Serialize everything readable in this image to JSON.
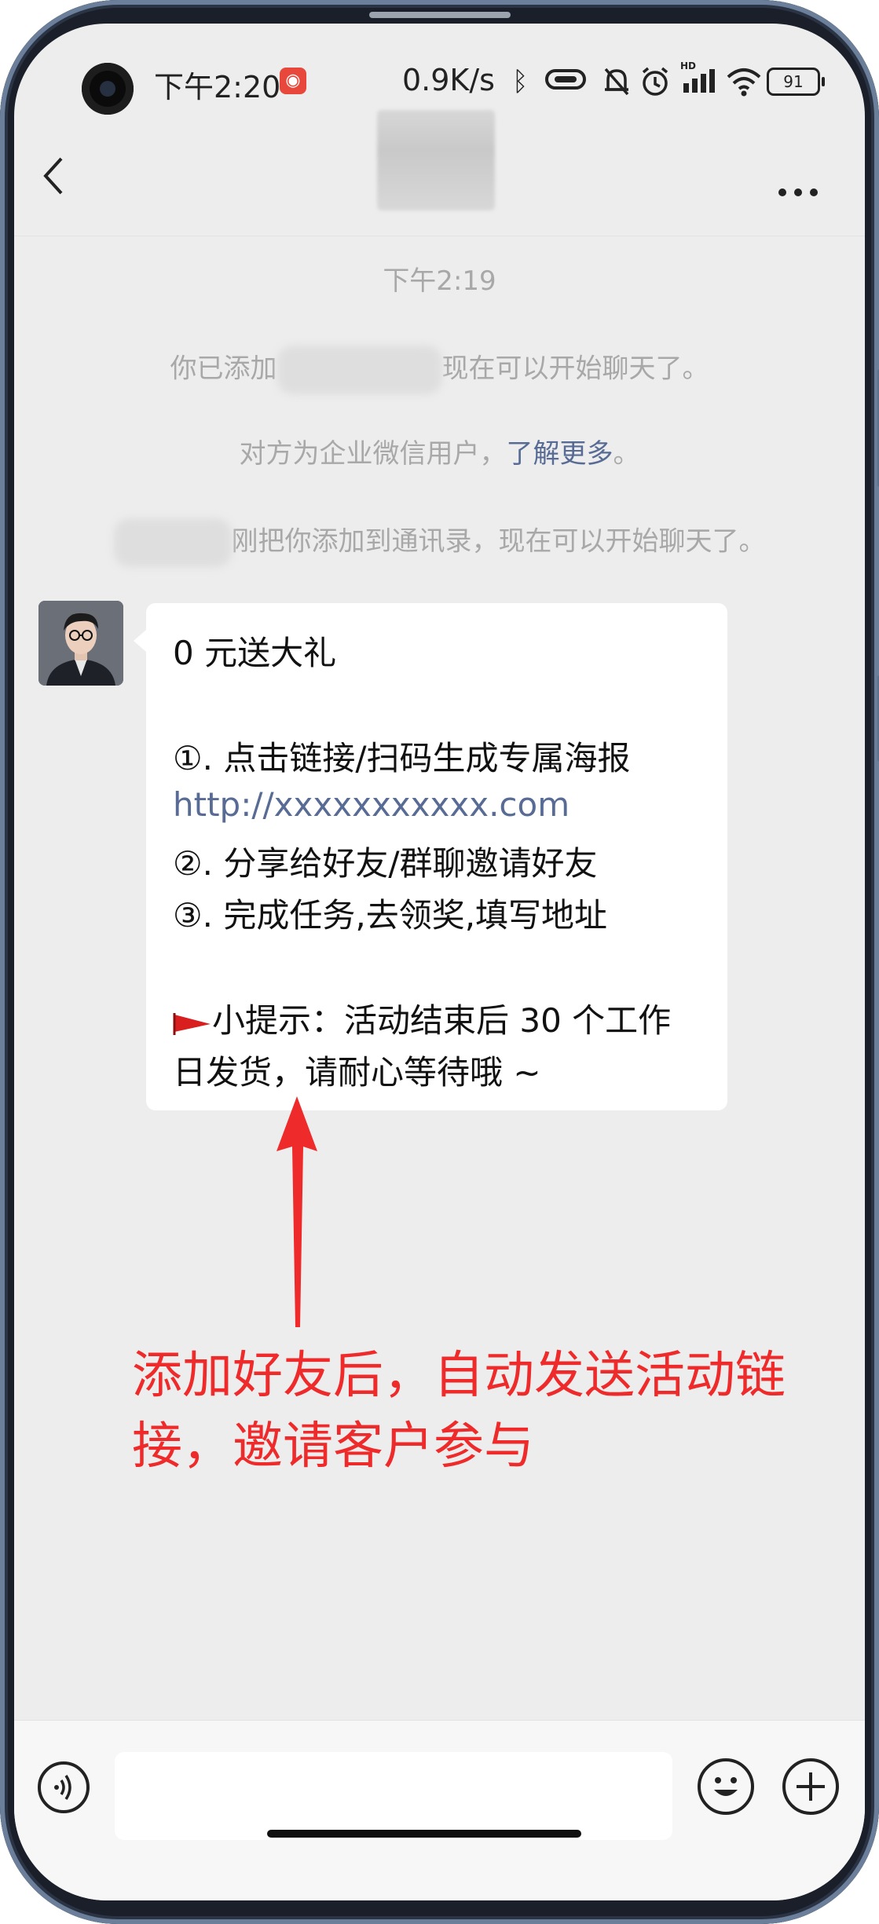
{
  "status_bar": {
    "time": "下午2:20",
    "net_speed": "0.9K/s",
    "battery": "91",
    "hd_label": "HD"
  },
  "chat": {
    "timestamp": "下午2:19",
    "system_messages": {
      "added_prefix": "你已添加",
      "added_suffix": "现在可以开始聊天了。",
      "enterprise_prefix": "对方为企业微信用户，",
      "enterprise_link": "了解更多",
      "enterprise_suffix": "。",
      "they_added_suffix": "刚把你添加到通讯录，现在可以开始聊天了。"
    },
    "message": {
      "line1": "0 元送大礼",
      "line2": "①. 点击链接/扫码生成专属海报",
      "line3": "http://xxxxxxxxxxx.com",
      "line4": "②. 分享给好友/群聊邀请好友",
      "line5": "③. 完成任务,去领奖,填写地址",
      "line6": "小提示：活动结束后 30 个工作",
      "line7": "日发货，请耐心等待哦 ~"
    }
  },
  "annotation": {
    "line1": "添加好友后，自动发送活动链",
    "line2": "接，邀请客户参与"
  },
  "icons": {
    "back": "back-icon",
    "more": "more-icon",
    "voice": "voice-icon",
    "emoji": "emoji-icon",
    "add": "add-icon"
  },
  "colors": {
    "link": "#576b95",
    "annotation": "#ee2a2a",
    "background": "#ededed"
  }
}
